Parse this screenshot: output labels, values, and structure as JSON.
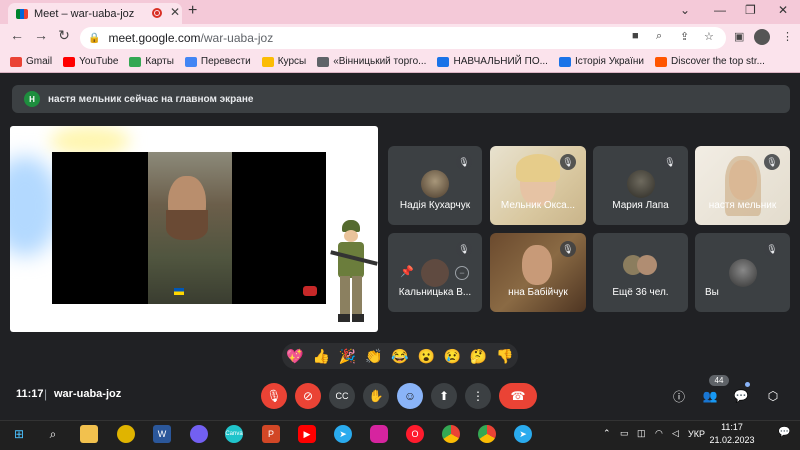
{
  "browser": {
    "tab_title": "Meet – war-uaba-joz",
    "new_tab": "+",
    "url_host": "meet.google.com",
    "url_path": "/war-uaba-joz",
    "bookmarks": [
      {
        "label": "Gmail",
        "color": "#ea4335"
      },
      {
        "label": "YouTube",
        "color": "#ff0000"
      },
      {
        "label": "Карты",
        "color": "#34a853"
      },
      {
        "label": "Перевести",
        "color": "#4285f4"
      },
      {
        "label": "Курсы",
        "color": "#fbbc04"
      },
      {
        "label": "«Вінницький торго...",
        "color": "#5f6368"
      },
      {
        "label": "НАВЧАЛЬНИЙ ПО...",
        "color": "#1a73e8"
      },
      {
        "label": "Історія України",
        "color": "#1a73e8"
      },
      {
        "label": "Discover the top str...",
        "color": "#ff5500"
      }
    ]
  },
  "meet": {
    "banner_avatar": "Н",
    "banner_text": "настя мельник сейчас на главном экране",
    "participants": [
      {
        "name": "Надія Кухарчук"
      },
      {
        "name": "Мельник Окса..."
      },
      {
        "name": "Мария Лапа"
      },
      {
        "name": "настя мельник"
      },
      {
        "name": "Кальницька В..."
      },
      {
        "name": "нна Бабійчук"
      },
      {
        "name": "Ещё 36 чел."
      },
      {
        "name": "Вы"
      }
    ],
    "reactions": [
      "💖",
      "👍",
      "🎉",
      "👏",
      "😂",
      "😮",
      "😢",
      "🤔",
      "👎"
    ],
    "time": "11:17",
    "separator": "|",
    "meeting_code": "war-uaba-joz",
    "people_count": "44"
  },
  "taskbar": {
    "lang": "УКР",
    "time": "11:17",
    "date": "21.02.2023"
  }
}
